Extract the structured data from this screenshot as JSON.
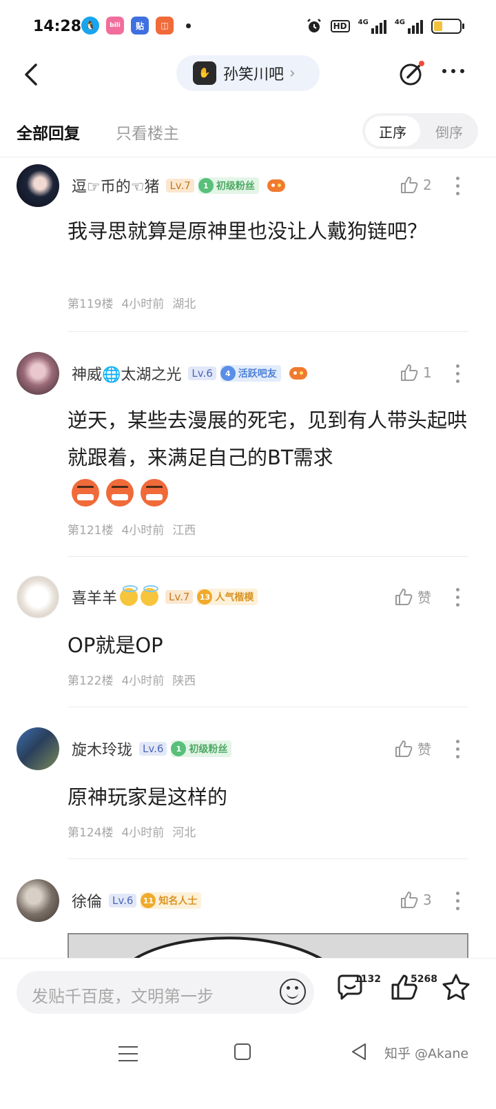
{
  "status_bar": {
    "time": "14:28",
    "app_icons": [
      {
        "name": "qq-icon",
        "color": "#1aa4ee"
      },
      {
        "name": "bilibili-icon",
        "color": "#f26d9b"
      },
      {
        "name": "tieba-icon",
        "color": "#3f6fe0"
      },
      {
        "name": "xiaohongshu-icon",
        "color": "#f06a3a"
      }
    ],
    "hd_label": "HD",
    "network_1": "4G",
    "network_2": "4G"
  },
  "header": {
    "forum_name": "孙笑川吧",
    "chevron": "›"
  },
  "filter": {
    "all_replies": "全部回复",
    "op_only": "只看楼主",
    "sort_asc": "正序",
    "sort_desc": "倒序"
  },
  "replies": [
    {
      "username": "逗☞币的☜猪",
      "level": "Lv.7",
      "badge_num": "1",
      "badge": "初级粉丝",
      "likes": "2",
      "content": "我寻思就算是原神里也没让人戴狗链吧？",
      "floor": "第119楼",
      "time": "4小时前",
      "location": "湖北"
    },
    {
      "username": "神威🌐太湖之光",
      "level": "Lv.6",
      "badge_num": "4",
      "badge": "活跃吧友",
      "likes": "1",
      "content": "逆天，某些去漫展的死宅，见到有人带头起哄就跟着，来满足自己的BT需求",
      "floor": "第121楼",
      "time": "4小时前",
      "location": "江西"
    },
    {
      "username": "喜羊羊",
      "level": "Lv.7",
      "badge_num": "13",
      "badge": "人气楷模",
      "likes": "赞",
      "content": "OP就是OP",
      "floor": "第122楼",
      "time": "4小时前",
      "location": "陕西"
    },
    {
      "username": "旋木玲珑",
      "level": "Lv.6",
      "badge_num": "1",
      "badge": "初级粉丝",
      "likes": "赞",
      "content": "原神玩家是这样的",
      "floor": "第124楼",
      "time": "4小时前",
      "location": "河北"
    },
    {
      "username": "徐倫",
      "level": "Lv.6",
      "badge_num": "11",
      "badge": "知名人士",
      "likes": "3"
    }
  ],
  "bottom_bar": {
    "input_placeholder": "发贴千百度，文明第一步",
    "comment_count": "1132",
    "like_count": "5268"
  },
  "watermark": "知乎 @Akane"
}
